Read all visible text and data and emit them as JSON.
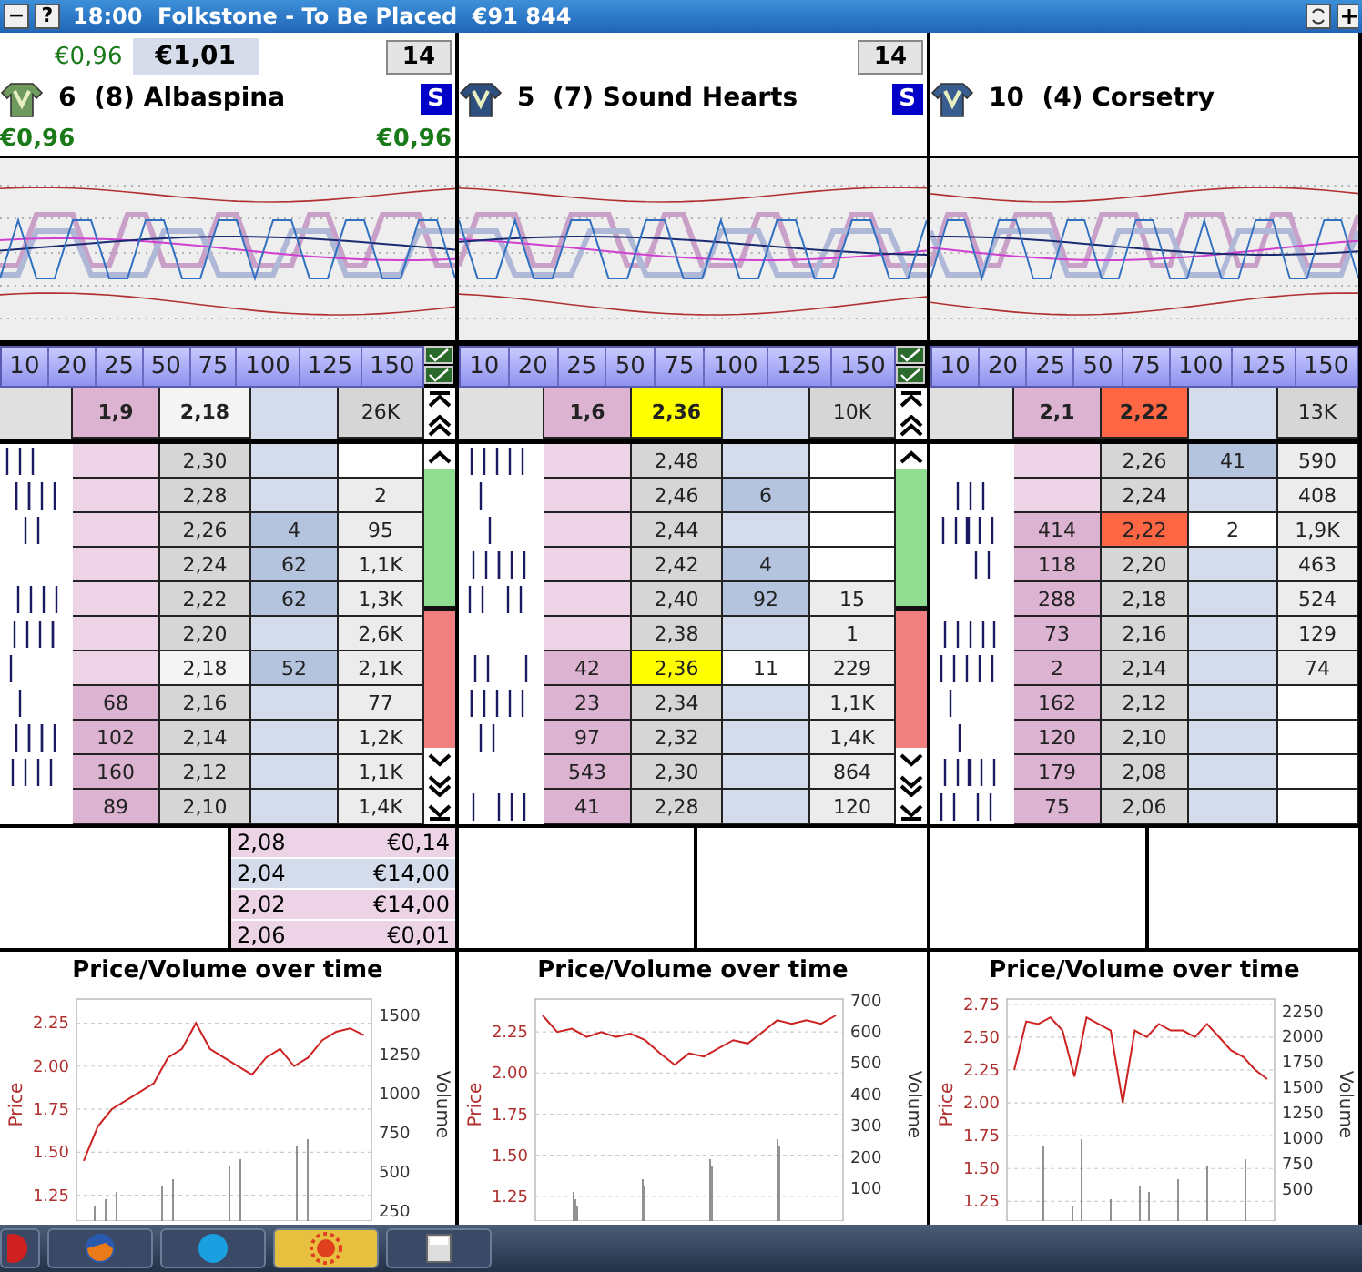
{
  "title_bar": {
    "buttons": [
      "−",
      "?"
    ],
    "title": "18:00  Folkstone - To Be Placed  €91 844"
  },
  "runners": [
    {
      "back_amount": "€0,96",
      "lay_amount": "€1,01",
      "count": "14",
      "name": "6  (8) Albaspina",
      "badge": "S",
      "silk": {
        "color": "#6f9a5e"
      },
      "profit_left": "€0,96",
      "profit_right": "€0,96",
      "scroll": true,
      "stakes": [
        "10",
        "20",
        "25",
        "50",
        "75",
        "100",
        "125",
        "150"
      ],
      "ladder_header": {
        "back": "1,9",
        "price": "2,18",
        "volume": "26K",
        "color": "#f4f4f4"
      },
      "rows": [
        {
          "back": "",
          "price": "2,30",
          "lay": "",
          "volume": "",
          "last_traded": false,
          "lay_highlighted": false
        },
        {
          "back": "",
          "price": "2,28",
          "lay": "",
          "volume": "2",
          "last_traded": false,
          "lay_highlighted": false
        },
        {
          "back": "",
          "price": "2,26",
          "lay": "4",
          "volume": "95",
          "last_traded": false,
          "lay_highlighted": false
        },
        {
          "back": "",
          "price": "2,24",
          "lay": "62",
          "volume": "1,1K",
          "last_traded": false,
          "lay_highlighted": false
        },
        {
          "back": "",
          "price": "2,22",
          "lay": "62",
          "volume": "1,3K",
          "last_traded": false,
          "lay_highlighted": false
        },
        {
          "back": "",
          "price": "2,20",
          "lay": "",
          "volume": "2,6K",
          "last_traded": false,
          "lay_highlighted": false
        },
        {
          "back": "",
          "price": "2,18",
          "lay": "52",
          "volume": "2,1K",
          "last_traded": true,
          "lay_highlighted": false
        },
        {
          "back": "68",
          "price": "2,16",
          "lay": "",
          "volume": "77",
          "last_traded": false,
          "lay_highlighted": false
        },
        {
          "back": "102",
          "price": "2,14",
          "lay": "",
          "volume": "1,2K",
          "last_traded": false,
          "lay_highlighted": false
        },
        {
          "back": "160",
          "price": "2,12",
          "lay": "",
          "volume": "1,1K",
          "last_traded": false,
          "lay_highlighted": false
        },
        {
          "back": "89",
          "price": "2,10",
          "lay": "",
          "volume": "1,4K",
          "last_traded": false,
          "lay_highlighted": false
        }
      ],
      "bets": [
        {
          "price": "2,08",
          "amount": "€0,14",
          "kind": "back"
        },
        {
          "price": "2,04",
          "amount": "€14,00",
          "kind": "lay"
        },
        {
          "price": "2,02",
          "amount": "€14,00",
          "kind": "back"
        },
        {
          "price": "2,06",
          "amount": "€0,01",
          "kind": "back"
        }
      ],
      "chart_data": {
        "type": "line",
        "title": "Price/Volume over time",
        "grid": true,
        "y2label": "Volume",
        "ylim": [
          1.1,
          2.39
        ],
        "y2lim": [
          185,
          1605
        ],
        "yticks": [
          {
            "value": 1.25,
            "label": "1.25"
          },
          {
            "value": 1.5,
            "label": "1.50"
          },
          {
            "value": 1.75,
            "label": "1.75"
          },
          {
            "value": 2,
            "label": "2.00"
          },
          {
            "value": 2.25,
            "label": "2.25"
          }
        ],
        "y2ticks": [
          250,
          500,
          750,
          1000,
          1250,
          1500
        ],
        "series": [
          {
            "name": "Price",
            "color": "#cc2222",
            "values": [
              1.45,
              1.65,
              1.75,
              1.8,
              1.85,
              1.9,
              2.05,
              2.1,
              2.25,
              2.1,
              2.05,
              2.0,
              1.95,
              2.05,
              2.1,
              2.0,
              2.05,
              2.15,
              2.2,
              2.22,
              2.18
            ]
          }
        ]
      }
    },
    {
      "count": "14",
      "name": "5  (7) Sound Hearts",
      "badge": "S",
      "silk": {
        "color": "#2c4f80"
      },
      "scroll": true,
      "stakes": [
        "10",
        "20",
        "25",
        "50",
        "75",
        "100",
        "125",
        "150"
      ],
      "ladder_header": {
        "back": "1,6",
        "price": "2,36",
        "volume": "10K",
        "color": "#ffff00"
      },
      "rows": [
        {
          "back": "",
          "price": "2,48",
          "lay": "",
          "volume": "",
          "last_traded": false,
          "lay_highlighted": false
        },
        {
          "back": "",
          "price": "2,46",
          "lay": "6",
          "volume": "",
          "last_traded": false,
          "lay_highlighted": false
        },
        {
          "back": "",
          "price": "2,44",
          "lay": "",
          "volume": "",
          "last_traded": false,
          "lay_highlighted": false
        },
        {
          "back": "",
          "price": "2,42",
          "lay": "4",
          "volume": "",
          "last_traded": false,
          "lay_highlighted": false
        },
        {
          "back": "",
          "price": "2,40",
          "lay": "92",
          "volume": "15",
          "last_traded": false,
          "lay_highlighted": false
        },
        {
          "back": "",
          "price": "2,38",
          "lay": "",
          "volume": "1",
          "last_traded": false,
          "lay_highlighted": false
        },
        {
          "back": "42",
          "price": "2,36",
          "lay": "11",
          "volume": "229",
          "last_traded": true,
          "lay_highlighted": true
        },
        {
          "back": "23",
          "price": "2,34",
          "lay": "",
          "volume": "1,1K",
          "last_traded": false,
          "lay_highlighted": false
        },
        {
          "back": "97",
          "price": "2,32",
          "lay": "",
          "volume": "1,4K",
          "last_traded": false,
          "lay_highlighted": false
        },
        {
          "back": "543",
          "price": "2,30",
          "lay": "",
          "volume": "864",
          "last_traded": false,
          "lay_highlighted": false
        },
        {
          "back": "41",
          "price": "2,28",
          "lay": "",
          "volume": "120",
          "last_traded": false,
          "lay_highlighted": false
        }
      ],
      "chart_data": {
        "type": "line",
        "title": "Price/Volume over time",
        "grid": true,
        "y2label": "Volume",
        "ylim": [
          1.1,
          2.45
        ],
        "y2lim": [
          -5,
          705
        ],
        "yticks": [
          {
            "value": 1.25,
            "label": "1.25"
          },
          {
            "value": 1.5,
            "label": "1.50"
          },
          {
            "value": 1.75,
            "label": "1.75"
          },
          {
            "value": 2,
            "label": "2.00"
          },
          {
            "value": 2.25,
            "label": "2.25"
          }
        ],
        "y2ticks": [
          100,
          200,
          300,
          400,
          500,
          600,
          700
        ],
        "series": [
          {
            "name": "Price",
            "color": "#cc2222",
            "values": [
              2.35,
              2.25,
              2.27,
              2.22,
              2.25,
              2.22,
              2.24,
              2.2,
              2.12,
              2.05,
              2.12,
              2.1,
              2.15,
              2.2,
              2.18,
              2.25,
              2.32,
              2.3,
              2.32,
              2.3,
              2.35
            ]
          }
        ]
      }
    },
    {
      "name": "10  (4) Corsetry",
      "silk": {
        "color": "#3a5d90"
      },
      "scroll": false,
      "stakes": [
        "10",
        "20",
        "25",
        "50",
        "75",
        "100",
        "125",
        "150"
      ],
      "ladder_header": {
        "back": "2,1",
        "price": "2,22",
        "volume": "13K",
        "color": "#ff6644"
      },
      "rows": [
        {
          "back": "",
          "price": "2,26",
          "lay": "41",
          "volume": "590",
          "last_traded": false,
          "lay_highlighted": false
        },
        {
          "back": "",
          "price": "2,24",
          "lay": "",
          "volume": "408",
          "last_traded": false,
          "lay_highlighted": false
        },
        {
          "back": "414",
          "price": "2,22",
          "lay": "2",
          "volume": "1,9K",
          "last_traded": true,
          "lay_highlighted": true
        },
        {
          "back": "118",
          "price": "2,20",
          "lay": "",
          "volume": "463",
          "last_traded": false,
          "lay_highlighted": false
        },
        {
          "back": "288",
          "price": "2,18",
          "lay": "",
          "volume": "524",
          "last_traded": false,
          "lay_highlighted": false
        },
        {
          "back": "73",
          "price": "2,16",
          "lay": "",
          "volume": "129",
          "last_traded": false,
          "lay_highlighted": false
        },
        {
          "back": "2",
          "price": "2,14",
          "lay": "",
          "volume": "74",
          "last_traded": false,
          "lay_highlighted": false
        },
        {
          "back": "162",
          "price": "2,12",
          "lay": "",
          "volume": "",
          "last_traded": false,
          "lay_highlighted": false
        },
        {
          "back": "120",
          "price": "2,10",
          "lay": "",
          "volume": "",
          "last_traded": false,
          "lay_highlighted": false
        },
        {
          "back": "179",
          "price": "2,08",
          "lay": "",
          "volume": "",
          "last_traded": false,
          "lay_highlighted": false
        },
        {
          "back": "75",
          "price": "2,06",
          "lay": "",
          "volume": "",
          "last_traded": false,
          "lay_highlighted": false
        }
      ],
      "chart_data": {
        "type": "line",
        "title": "Price/Volume over time",
        "grid": true,
        "y2label": "Volume",
        "ylim": [
          1.1,
          2.79
        ],
        "y2lim": [
          185,
          2371
        ],
        "yticks": [
          {
            "value": 1.25,
            "label": "1.25"
          },
          {
            "value": 1.5,
            "label": "1.50"
          },
          {
            "value": 1.75,
            "label": "1.75"
          },
          {
            "value": 2,
            "label": "2.00"
          },
          {
            "value": 2.25,
            "label": "2.25"
          },
          {
            "value": 2.5,
            "label": "2.50"
          },
          {
            "value": 2.75,
            "label": "2.75"
          }
        ],
        "y2ticks": [
          500,
          750,
          1000,
          1250,
          1500,
          1750,
          2000,
          2250
        ],
        "series": [
          {
            "name": "Price",
            "color": "#cc2222",
            "values": [
              2.25,
              2.62,
              2.6,
              2.65,
              2.55,
              2.2,
              2.65,
              2.6,
              2.55,
              2.0,
              2.55,
              2.5,
              2.6,
              2.55,
              2.55,
              2.5,
              2.6,
              2.5,
              2.4,
              2.35,
              2.25,
              2.18
            ]
          }
        ]
      }
    }
  ]
}
